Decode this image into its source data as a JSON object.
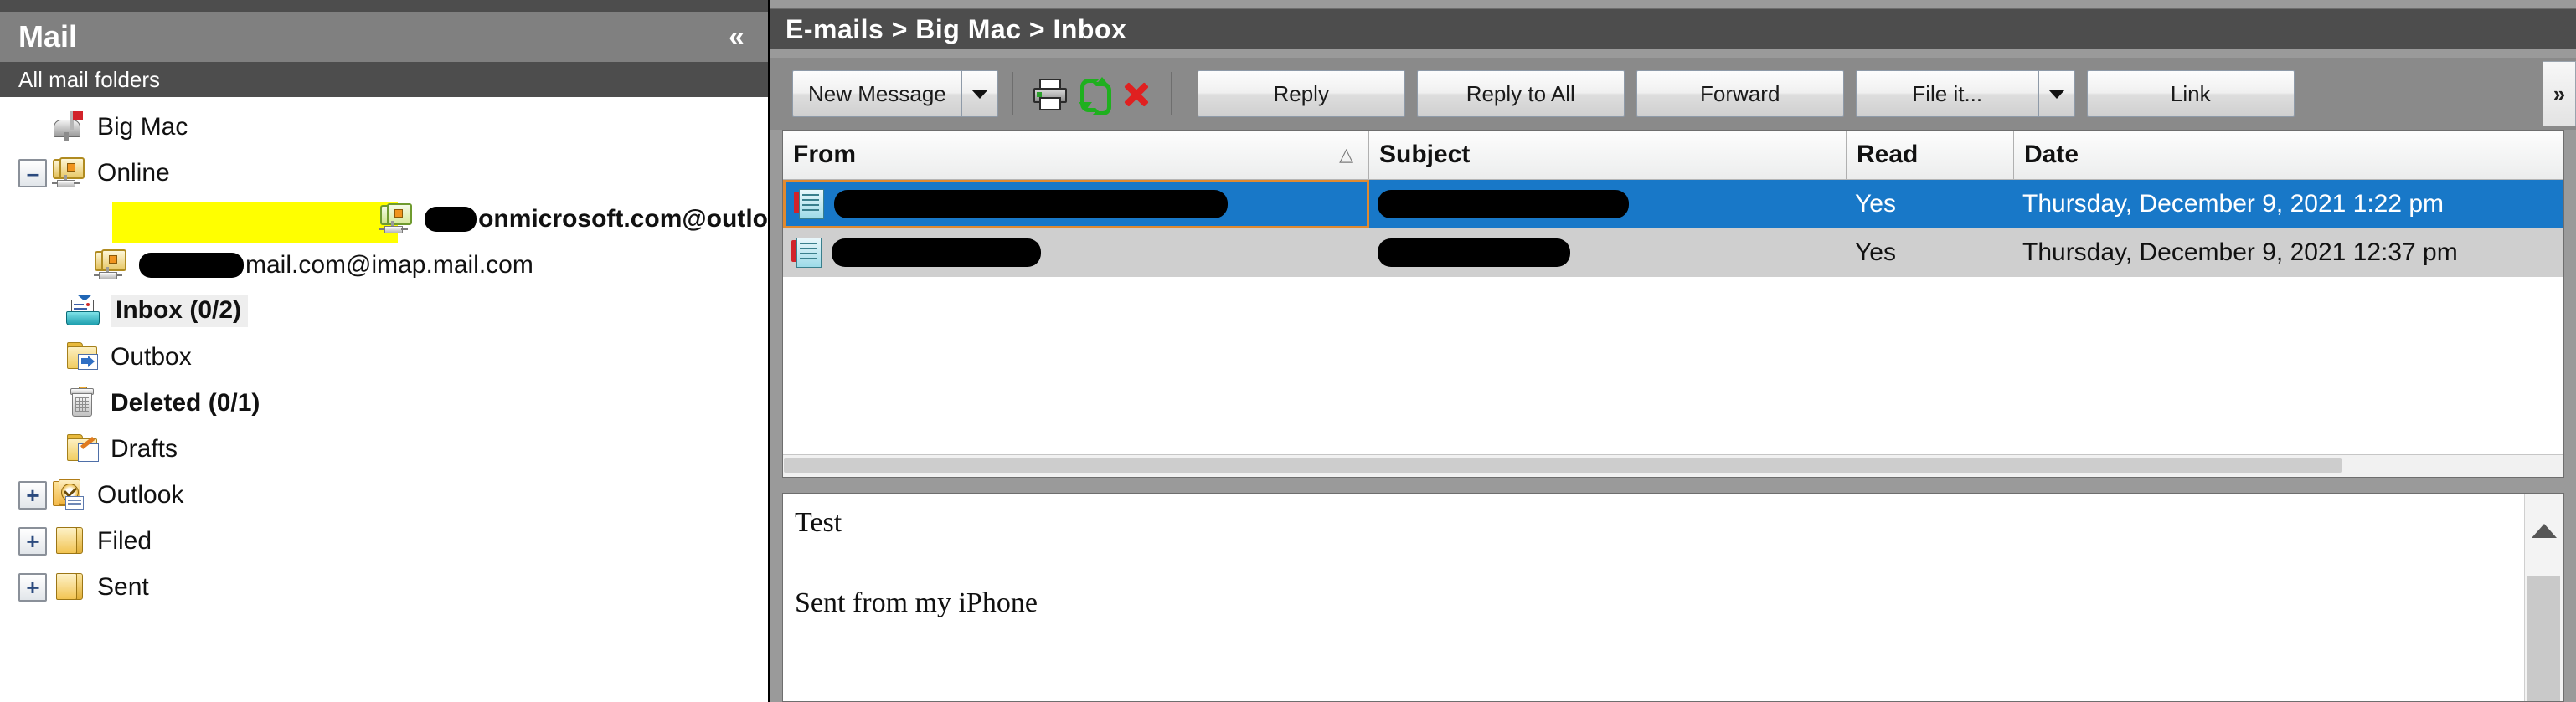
{
  "left_panel": {
    "title": "Mail",
    "collapse_icon": "chevron-double-left-icon",
    "subheader": "All mail folders",
    "tree": [
      {
        "label": "Big Mac",
        "icon": "mailbox-icon",
        "indent": 0,
        "twisty": "none",
        "bold": false,
        "highlighted": false,
        "selected": false
      },
      {
        "label": "Online",
        "icon": "server-icon",
        "indent": 1,
        "twisty": "minus",
        "twisty_glyph": "–",
        "bold": false,
        "highlighted": false,
        "selected": false
      },
      {
        "label_prefix_redacted": true,
        "label": "onmicrosoft.com@outlo",
        "icon": "server-icon-green",
        "indent": 2,
        "twisty": "none",
        "bold": true,
        "highlighted": true,
        "selected": false,
        "redact_width": 150
      },
      {
        "label_prefix_redacted": true,
        "label": "mail.com@imap.mail.com",
        "icon": "server-icon",
        "indent": 2,
        "twisty": "none",
        "bold": false,
        "highlighted": false,
        "selected": false,
        "redact_width": 125
      },
      {
        "label": "Inbox (0/2)",
        "icon": "inbox-icon",
        "indent": 2,
        "twisty": "none",
        "bold": true,
        "highlighted": false,
        "selected": true
      },
      {
        "label": "Outbox",
        "icon": "outbox-folder-icon",
        "indent": 2,
        "twisty": "none",
        "bold": false,
        "highlighted": false,
        "selected": false
      },
      {
        "label": "Deleted (0/1)",
        "icon": "trash-icon",
        "indent": 2,
        "twisty": "none",
        "bold": true,
        "highlighted": false,
        "selected": false
      },
      {
        "label": "Drafts",
        "icon": "drafts-folder-icon",
        "indent": 2,
        "twisty": "none",
        "bold": false,
        "highlighted": false,
        "selected": false
      },
      {
        "label": "Outlook",
        "icon": "outlook-icon",
        "indent": 1,
        "twisty": "plus",
        "twisty_glyph": "+",
        "bold": false,
        "highlighted": false,
        "selected": false
      },
      {
        "label": "Filed",
        "icon": "plain-folder-icon",
        "indent": 1,
        "twisty": "plus",
        "twisty_glyph": "+",
        "bold": false,
        "highlighted": false,
        "selected": false
      },
      {
        "label": "Sent",
        "icon": "plain-folder-icon",
        "indent": 1,
        "twisty": "plus",
        "twisty_glyph": "+",
        "bold": false,
        "highlighted": false,
        "selected": false
      }
    ]
  },
  "right_panel": {
    "breadcrumb": "E-mails > Big Mac > Inbox",
    "toolbar": {
      "new_message_label": "New Message",
      "new_message_dropdown_icon": "caret-down-icon",
      "print_icon": "printer-icon",
      "sync_icon": "sync-arrows-icon",
      "delete_icon": "red-x-icon",
      "reply_label": "Reply",
      "reply_all_label": "Reply to All",
      "forward_label": "Forward",
      "file_it_label": "File it...",
      "file_it_dropdown_icon": "caret-down-icon",
      "link_label": "Link",
      "overflow_label": "»"
    },
    "message_list": {
      "columns": [
        {
          "key": "from",
          "label": "From",
          "sort_indicator": "△"
        },
        {
          "key": "subject",
          "label": "Subject"
        },
        {
          "key": "read",
          "label": "Read"
        },
        {
          "key": "date",
          "label": "Date"
        }
      ],
      "rows": [
        {
          "icon": "message-flagged-icon",
          "from": "",
          "from_redacted": true,
          "from_redact_width": 470,
          "subject": "",
          "subject_redacted": true,
          "subject_redact_width": 300,
          "read": "Yes",
          "date": "Thursday, December 9, 2021  1:22 pm",
          "selected": true
        },
        {
          "icon": "message-flagged-icon",
          "from": "",
          "from_redacted": true,
          "from_redact_width": 250,
          "subject": "",
          "subject_redacted": true,
          "subject_redact_width": 230,
          "read": "Yes",
          "date": "Thursday, December 9, 2021  12:37 pm",
          "selected": false
        }
      ]
    },
    "preview": {
      "line1": "Test",
      "line2": "Sent from my iPhone",
      "scroll_up_icon": "scroll-up-arrow-icon"
    }
  },
  "colors": {
    "titlebar": "#808080",
    "subheader": "#4d4d4d",
    "selection_blue": "#1878c8",
    "highlight_yellow": "#ffff00",
    "focus_orange": "#e08a30",
    "redact_black": "#000000",
    "toolbar_gray": "#8a8a8a"
  }
}
